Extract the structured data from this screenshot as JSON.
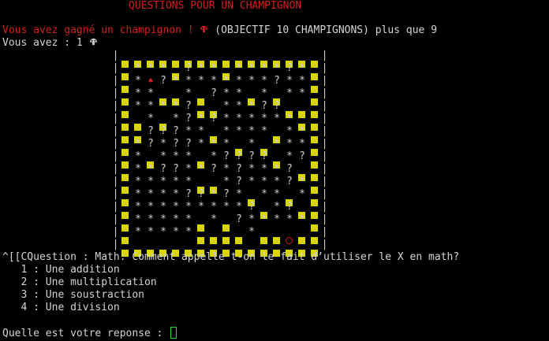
{
  "header": {
    "title": "QUESTIONS POUR UN CHAMPIGNON"
  },
  "status": {
    "win_message": "Vous avez gagné un champignon ! ",
    "objective": " (OBJECTIF 10 CHAMPIGNONS) plus que 9",
    "have_label": "Vous avez : 1 "
  },
  "board": {
    "border_char": "|",
    "rows": [
      "################",
      "#***#?**#****?*#",
      "#*M?********?**#",
      "#**##*#?**#*#**#",
      "#****?##***??###",
      "##*#*?*?******##",
      "##???**#****#**#",
      "#*?*??***#*#***#",
      "#*#***#*????#*?#",
      "#**??**?*?***?##",
      "#*****##*?***?*#",
      "#****??*?*#**#*#",
      "#*********?#*?##",
      "#*****#*#?*****#",
      "#*****####*##O##",
      "################"
    ],
    "legend": {
      "#": "wall",
      "*": "star",
      "?": "question",
      "M": "mushroom",
      "O": "player"
    }
  },
  "question": {
    "text": "^[[CQuestion : Math: Comment appelle t-on le fait d’utiliser le X en math?",
    "options": [
      "   1 : Une addition",
      "   2 : Une multiplication",
      "   3 : Une soustraction",
      "   4 : Une division"
    ]
  },
  "prompt": {
    "label": "Quelle est votre reponse : "
  },
  "colors": {
    "accent_red": "#d21f1f",
    "wall_yellow": "#d6d600",
    "cursor_green": "#32d832",
    "text": "#d4d4d4"
  },
  "icons": {
    "mushroom": "mushroom-icon"
  }
}
